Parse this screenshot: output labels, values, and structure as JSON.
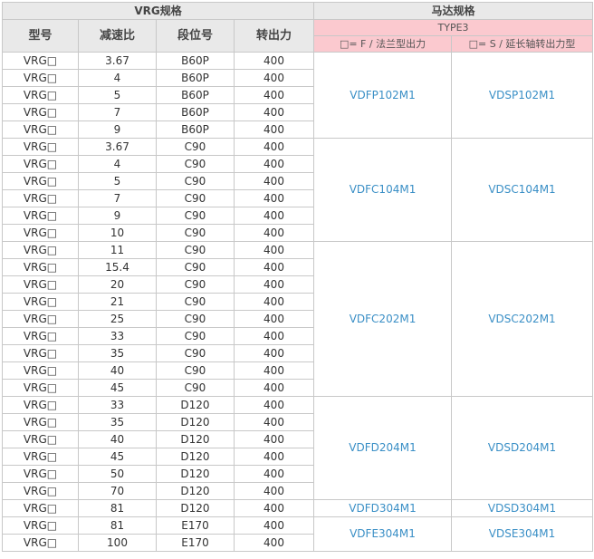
{
  "headers": {
    "vrg_spec": "VRG规格",
    "motor_spec": "马达规格",
    "model": "型号",
    "ratio": "减速比",
    "step": "段位号",
    "output": "转出力",
    "type": "TYPE3",
    "flange": "□= F / 法兰型出力",
    "shaft": "□= S / 延长轴转出力型"
  },
  "rows": [
    {
      "model": "VRG□",
      "ratio": "3.67",
      "step": "B60P",
      "output": "400"
    },
    {
      "model": "VRG□",
      "ratio": "4",
      "step": "B60P",
      "output": "400"
    },
    {
      "model": "VRG□",
      "ratio": "5",
      "step": "B60P",
      "output": "400"
    },
    {
      "model": "VRG□",
      "ratio": "7",
      "step": "B60P",
      "output": "400"
    },
    {
      "model": "VRG□",
      "ratio": "9",
      "step": "B60P",
      "output": "400"
    },
    {
      "model": "VRG□",
      "ratio": "3.67",
      "step": "C90",
      "output": "400"
    },
    {
      "model": "VRG□",
      "ratio": "4",
      "step": "C90",
      "output": "400"
    },
    {
      "model": "VRG□",
      "ratio": "5",
      "step": "C90",
      "output": "400"
    },
    {
      "model": "VRG□",
      "ratio": "7",
      "step": "C90",
      "output": "400"
    },
    {
      "model": "VRG□",
      "ratio": "9",
      "step": "C90",
      "output": "400"
    },
    {
      "model": "VRG□",
      "ratio": "10",
      "step": "C90",
      "output": "400"
    },
    {
      "model": "VRG□",
      "ratio": "11",
      "step": "C90",
      "output": "400"
    },
    {
      "model": "VRG□",
      "ratio": "15.4",
      "step": "C90",
      "output": "400"
    },
    {
      "model": "VRG□",
      "ratio": "20",
      "step": "C90",
      "output": "400"
    },
    {
      "model": "VRG□",
      "ratio": "21",
      "step": "C90",
      "output": "400"
    },
    {
      "model": "VRG□",
      "ratio": "25",
      "step": "C90",
      "output": "400"
    },
    {
      "model": "VRG□",
      "ratio": "33",
      "step": "C90",
      "output": "400"
    },
    {
      "model": "VRG□",
      "ratio": "35",
      "step": "C90",
      "output": "400"
    },
    {
      "model": "VRG□",
      "ratio": "40",
      "step": "C90",
      "output": "400"
    },
    {
      "model": "VRG□",
      "ratio": "45",
      "step": "C90",
      "output": "400"
    },
    {
      "model": "VRG□",
      "ratio": "33",
      "step": "D120",
      "output": "400"
    },
    {
      "model": "VRG□",
      "ratio": "35",
      "step": "D120",
      "output": "400"
    },
    {
      "model": "VRG□",
      "ratio": "40",
      "step": "D120",
      "output": "400"
    },
    {
      "model": "VRG□",
      "ratio": "45",
      "step": "D120",
      "output": "400"
    },
    {
      "model": "VRG□",
      "ratio": "50",
      "step": "D120",
      "output": "400"
    },
    {
      "model": "VRG□",
      "ratio": "70",
      "step": "D120",
      "output": "400"
    },
    {
      "model": "VRG□",
      "ratio": "81",
      "step": "D120",
      "output": "400"
    },
    {
      "model": "VRG□",
      "ratio": "81",
      "step": "E170",
      "output": "400"
    },
    {
      "model": "VRG□",
      "ratio": "100",
      "step": "E170",
      "output": "400"
    }
  ],
  "motor_groups": [
    {
      "start": 0,
      "span": 5,
      "flange": "VDFP102M1",
      "shaft": "VDSP102M1"
    },
    {
      "start": 5,
      "span": 6,
      "flange": "VDFC104M1",
      "shaft": "VDSC104M1"
    },
    {
      "start": 11,
      "span": 9,
      "flange": "VDFC202M1",
      "shaft": "VDSC202M1"
    },
    {
      "start": 20,
      "span": 6,
      "flange": "VDFD204M1",
      "shaft": "VDSD204M1"
    },
    {
      "start": 26,
      "span": 1,
      "flange": "VDFD304M1",
      "shaft": "VDSD304M1"
    },
    {
      "start": 27,
      "span": 2,
      "flange": "VDFE304M1",
      "shaft": "VDSE304M1"
    }
  ]
}
